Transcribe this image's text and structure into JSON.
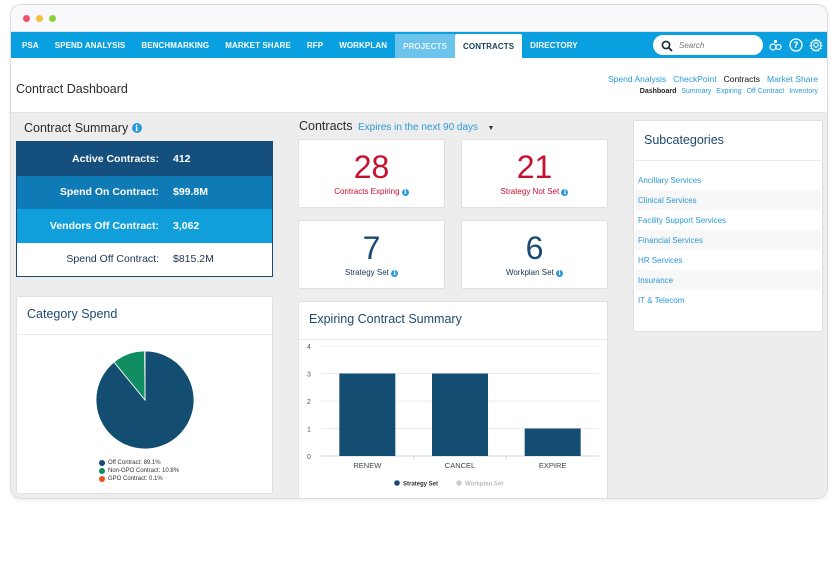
{
  "window": {
    "traffic_lights": [
      "close",
      "minimize",
      "maximize"
    ]
  },
  "nav": {
    "items": [
      {
        "label": "PSA"
      },
      {
        "label": "SPEND ANALYSIS"
      },
      {
        "label": "BENCHMARKING"
      },
      {
        "label": "MARKET SHARE"
      },
      {
        "label": "RFP"
      },
      {
        "label": "WORKPLAN"
      },
      {
        "label": "PROJECTS"
      },
      {
        "label": "CONTRACTS"
      },
      {
        "label": "DIRECTORY"
      }
    ],
    "active": "CONTRACTS",
    "search_placeholder": "Search",
    "icons": [
      "users-icon",
      "help-icon",
      "gear-icon"
    ]
  },
  "header": {
    "title": "Contract Dashboard",
    "subnav_primary": [
      {
        "label": "Spend Analysis"
      },
      {
        "label": "CheckPoint"
      },
      {
        "label": "Contracts"
      },
      {
        "label": "Market Share"
      }
    ],
    "subnav_secondary": [
      {
        "label": "Dashboard"
      },
      {
        "label": "Summary"
      },
      {
        "label": "Expiring"
      },
      {
        "label": "Off Contract"
      },
      {
        "label": "Inventory"
      }
    ]
  },
  "contract_summary": {
    "title": "Contract Summary",
    "rows": [
      {
        "label": "Active Contracts:",
        "value": "412"
      },
      {
        "label": "Spend On Contract:",
        "value": "$99.8M"
      },
      {
        "label": "Vendors Off Contract:",
        "value": "3,062"
      },
      {
        "label": "Spend Off Contract:",
        "value": "$815.2M"
      }
    ]
  },
  "contracts": {
    "title": "Contracts",
    "filter": "Expires in the next 90 days",
    "cards": [
      {
        "value": "28",
        "label": "Contracts Expiring"
      },
      {
        "value": "21",
        "label": "Strategy Not Set"
      },
      {
        "value": "7",
        "label": "Strategy Set"
      },
      {
        "value": "6",
        "label": "Workplan Set"
      }
    ]
  },
  "subcategories": {
    "title": "Subcategories",
    "items": [
      "Ancillary Services",
      "Clinical Services",
      "Facility Support Services",
      "Financial Services",
      "HR Services",
      "Insurance",
      "IT & Telecom"
    ]
  },
  "chart_data": [
    {
      "type": "pie",
      "title": "Category Spend",
      "slices": [
        {
          "label": "Off Contract",
          "value": 89.1,
          "display": "Off Contract: 89.1%",
          "color": "#134d72"
        },
        {
          "label": "Non-GPO Contract",
          "value": 10.8,
          "display": "Non-GPO Contract: 10.8%",
          "color": "#118d62"
        },
        {
          "label": "GPO Contract",
          "value": 0.1,
          "display": "GPO Contract: 0.1%",
          "color": "#e8541c"
        }
      ],
      "legend": "bottom"
    },
    {
      "type": "bar",
      "title": "Expiring Contract Summary",
      "categories": [
        "RENEW",
        "CANCEL",
        "EXPIRE"
      ],
      "series": [
        {
          "name": "Strategy Set",
          "values": [
            3,
            3,
            1
          ],
          "color": "#134d72"
        },
        {
          "name": "Workplan Set",
          "values": [
            0,
            0,
            0
          ],
          "color": "#cccccc"
        }
      ],
      "yticks": [
        "0",
        "1",
        "2",
        "3",
        "4"
      ],
      "ylim": [
        0,
        4
      ],
      "grid": true,
      "legend": "bottom"
    }
  ]
}
